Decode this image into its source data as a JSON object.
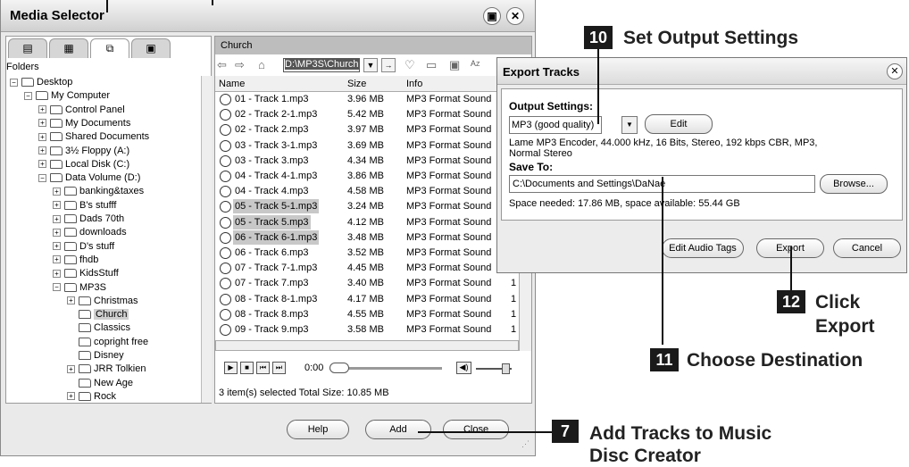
{
  "media_selector": {
    "title": "Media Selector",
    "left_tabs": [
      "▤",
      "▦",
      "⧉",
      "▣"
    ],
    "folders_label": "Folders",
    "tree": [
      {
        "label": "Desktop",
        "level": 0,
        "pm": "−"
      },
      {
        "label": "My Computer",
        "level": 1,
        "pm": "−"
      },
      {
        "label": "Control Panel",
        "level": 2,
        "pm": "+"
      },
      {
        "label": "My Documents",
        "level": 2,
        "pm": "+"
      },
      {
        "label": "Shared Documents",
        "level": 2,
        "pm": "+"
      },
      {
        "label": "3½ Floppy (A:)",
        "level": 2,
        "pm": "+"
      },
      {
        "label": "Local Disk (C:)",
        "level": 2,
        "pm": "+"
      },
      {
        "label": "Data Volume (D:)",
        "level": 2,
        "pm": "−"
      },
      {
        "label": "banking&taxes",
        "level": 3,
        "pm": "+"
      },
      {
        "label": "B's stufff",
        "level": 3,
        "pm": "+"
      },
      {
        "label": "Dads 70th",
        "level": 3,
        "pm": "+"
      },
      {
        "label": "downloads",
        "level": 3,
        "pm": "+"
      },
      {
        "label": "D's stuff",
        "level": 3,
        "pm": "+"
      },
      {
        "label": "fhdb",
        "level": 3,
        "pm": "+"
      },
      {
        "label": "KidsStuff",
        "level": 3,
        "pm": "+"
      },
      {
        "label": "MP3S",
        "level": 3,
        "pm": "−"
      },
      {
        "label": "Christmas",
        "level": 4,
        "pm": "+"
      },
      {
        "label": "Church",
        "level": 4,
        "pm": "",
        "selected": true
      },
      {
        "label": "Classics",
        "level": 4,
        "pm": ""
      },
      {
        "label": "copright free",
        "level": 4,
        "pm": ""
      },
      {
        "label": "Disney",
        "level": 4,
        "pm": ""
      },
      {
        "label": "JRR Tolkien",
        "level": 4,
        "pm": "+"
      },
      {
        "label": "New Age",
        "level": 4,
        "pm": ""
      },
      {
        "label": "Rock",
        "level": 4,
        "pm": "+"
      }
    ],
    "folder_header": "Church",
    "path": "D:\\MP3S\\Church",
    "columns": {
      "name": "Name",
      "size": "Size",
      "info": "Info"
    },
    "tracks": [
      {
        "name": "01 - Track 1.mp3",
        "size": "3.96 MB",
        "info": "MP3 Format Sound",
        "extra": ""
      },
      {
        "name": "02 - Track 2-1.mp3",
        "size": "5.42 MB",
        "info": "MP3 Format Sound",
        "extra": ""
      },
      {
        "name": "02 - Track 2.mp3",
        "size": "3.97 MB",
        "info": "MP3 Format Sound",
        "extra": ""
      },
      {
        "name": "03 - Track 3-1.mp3",
        "size": "3.69 MB",
        "info": "MP3 Format Sound",
        "extra": ""
      },
      {
        "name": "03 - Track 3.mp3",
        "size": "4.34 MB",
        "info": "MP3 Format Sound",
        "extra": ""
      },
      {
        "name": "04 - Track 4-1.mp3",
        "size": "3.86 MB",
        "info": "MP3 Format Sound",
        "extra": ""
      },
      {
        "name": "04 - Track 4.mp3",
        "size": "4.58 MB",
        "info": "MP3 Format Sound",
        "extra": ""
      },
      {
        "name": "05 - Track 5-1.mp3",
        "size": "3.24 MB",
        "info": "MP3 Format Sound",
        "extra": "",
        "selected": true
      },
      {
        "name": "05 - Track 5.mp3",
        "size": "4.12 MB",
        "info": "MP3 Format Sound",
        "extra": "",
        "selected": true
      },
      {
        "name": "06 - Track 6-1.mp3",
        "size": "3.48 MB",
        "info": "MP3 Format Sound",
        "extra": "",
        "selected": true
      },
      {
        "name": "06 - Track 6.mp3",
        "size": "3.52 MB",
        "info": "MP3 Format Sound",
        "extra": ""
      },
      {
        "name": "07 - Track 7-1.mp3",
        "size": "4.45 MB",
        "info": "MP3 Format Sound",
        "extra": "1"
      },
      {
        "name": "07 - Track 7.mp3",
        "size": "3.40 MB",
        "info": "MP3 Format Sound",
        "extra": "1"
      },
      {
        "name": "08 - Track 8-1.mp3",
        "size": "4.17 MB",
        "info": "MP3 Format Sound",
        "extra": "1"
      },
      {
        "name": "08 - Track 8.mp3",
        "size": "4.55 MB",
        "info": "MP3 Format Sound",
        "extra": "1"
      },
      {
        "name": "09 - Track 9.mp3",
        "size": "3.58 MB",
        "info": "MP3 Format Sound",
        "extra": "1"
      }
    ],
    "player_time": "0:00",
    "status": "3 item(s) selected   Total Size: 10.85 MB",
    "buttons": {
      "help": "Help",
      "add": "Add",
      "close": "Close"
    }
  },
  "export_dialog": {
    "title": "Export Tracks",
    "output_settings_label": "Output Settings:",
    "output_value": "MP3 (good quality)",
    "edit_button": "Edit",
    "encoder_line1": "Lame MP3 Encoder, 44.000 kHz, 16 Bits, Stereo, 192 kbps CBR, MP3,",
    "encoder_line2": "Normal Stereo",
    "save_to_label": "Save To:",
    "save_to_value": "C:\\Documents and Settings\\DaNae",
    "browse_button": "Browse...",
    "space_info": "Space needed: 17.86 MB, space available: 55.44 GB",
    "edit_tags_button": "Edit Audio Tags",
    "export_button": "Export",
    "cancel_button": "Cancel"
  },
  "callouts": {
    "c10_num": "10",
    "c10_text": "Set Output Settings",
    "c12_num": "12",
    "c12_text1": "Click",
    "c12_text2": "Export",
    "c11_num": "11",
    "c11_text": "Choose Destination",
    "c7_num": "7",
    "c7_text1": "Add Tracks to Music",
    "c7_text2": "Disc Creator"
  }
}
